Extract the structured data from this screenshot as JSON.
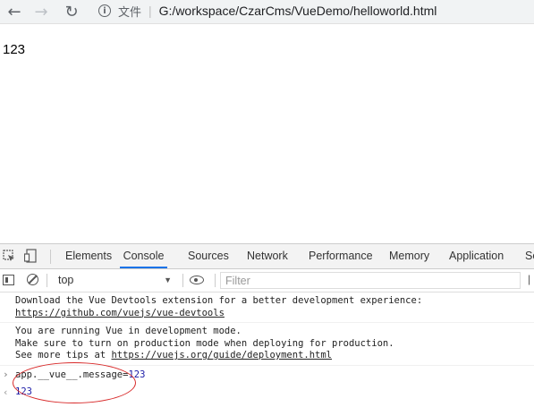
{
  "browser": {
    "address_label": "文件",
    "url": "G:/workspace/CzarCms/VueDemo/helloworld.html"
  },
  "page": {
    "content": "123"
  },
  "devtools": {
    "tabs": [
      "Elements",
      "Console",
      "Sources",
      "Network",
      "Performance",
      "Memory",
      "Application",
      "Se"
    ],
    "active_tab": "Console",
    "toolbar": {
      "context": "top",
      "filter_placeholder": "Filter"
    },
    "messages": {
      "devtools_line1": "Download the Vue Devtools extension for a better development experience:",
      "devtools_link": "https://github.com/vuejs/vue-devtools",
      "mode_line1": "You are running Vue in development mode.",
      "mode_line2": "Make sure to turn on production mode when deploying for production.",
      "mode_line3_prefix": "See more tips at ",
      "mode_link": "https://vuejs.org/guide/deployment.html"
    },
    "command": {
      "expression": "app.__vue__.message=",
      "value": "123"
    },
    "result": "123"
  },
  "colors": {
    "link_underline": "#222222",
    "number": "#1a1aa6",
    "annotation": "#d82a2a",
    "active_tab": "#1a73e8"
  },
  "icons": [
    "back-arrow-icon",
    "forward-arrow-icon",
    "reload-icon",
    "info-icon",
    "inspect-icon",
    "device-toggle-icon",
    "sidebar-icon",
    "clear-console-icon",
    "eye-icon"
  ]
}
